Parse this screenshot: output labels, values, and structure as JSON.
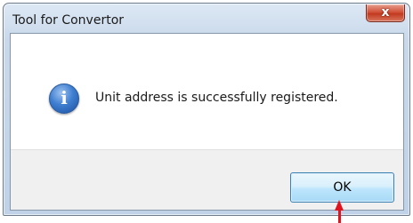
{
  "window": {
    "title": "Tool for Convertor",
    "close_glyph": "x"
  },
  "dialog": {
    "icon": "info-icon",
    "icon_glyph": "i",
    "message": "Unit address is successfully registered."
  },
  "buttons": {
    "ok_label": "OK"
  },
  "colors": {
    "arrow": "#e0141e",
    "close_button": "#c23a1f",
    "ok_border": "#3c7fb1"
  }
}
